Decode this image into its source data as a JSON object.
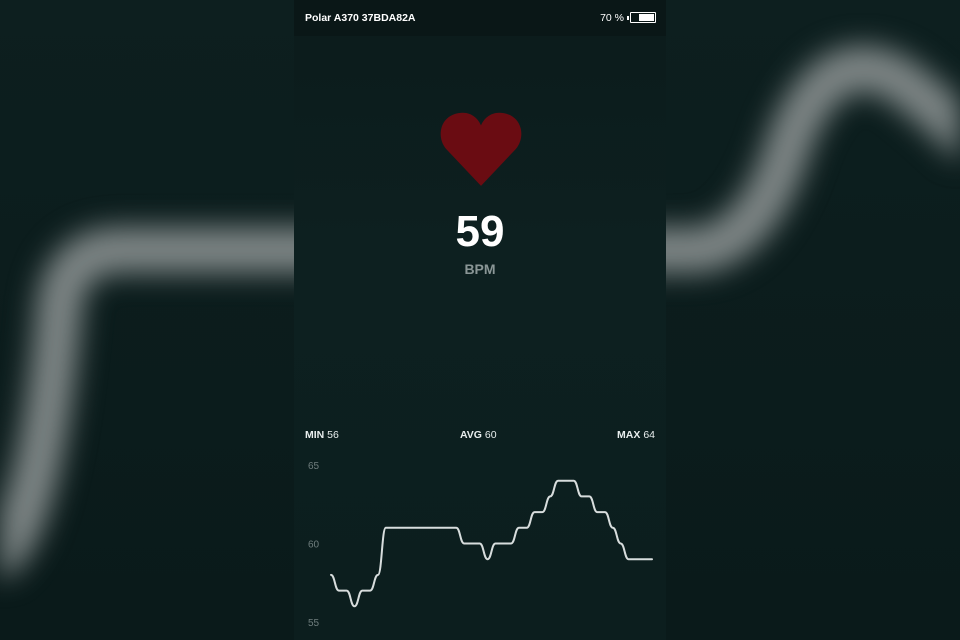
{
  "status_bar": {
    "device_name": "Polar A370 37BDA82A",
    "battery_percent": "70 %",
    "battery_level": 0.7
  },
  "heart_rate": {
    "value": "59",
    "unit": "BPM",
    "heart_color": "#6a0c12"
  },
  "stats": {
    "min_label": "MIN",
    "min_value": "56",
    "avg_label": "AVG",
    "avg_value": "60",
    "max_label": "MAX",
    "max_value": "64"
  },
  "chart_data": {
    "type": "line",
    "title": "",
    "xlabel": "",
    "ylabel": "",
    "ylim": [
      55,
      65
    ],
    "yticks": [
      "65",
      "60",
      "55"
    ],
    "line_color": "#d8dddd",
    "series": [
      {
        "values": [
          58,
          57,
          57,
          56,
          57,
          57,
          58,
          61,
          61,
          61,
          61,
          61,
          61,
          61,
          61,
          61,
          61,
          60,
          60,
          60,
          59,
          60,
          60,
          60,
          61,
          61,
          62,
          62,
          63,
          64,
          64,
          64,
          63,
          63,
          62,
          62,
          61,
          60,
          59,
          59,
          59,
          59
        ]
      }
    ]
  }
}
